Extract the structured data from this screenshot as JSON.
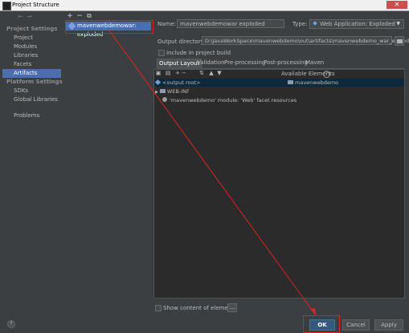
{
  "window": {
    "title": "Project Structure",
    "close_glyph": "✕"
  },
  "nav": {
    "toolbar": {
      "back": "←",
      "forward": "→"
    },
    "sections": [
      {
        "label": "Project Settings",
        "items": [
          "Project",
          "Modules",
          "Libraries",
          "Facets",
          "Artifacts"
        ]
      },
      {
        "label": "Platform Settings",
        "items": [
          "SDKs",
          "Global Libraries"
        ]
      }
    ],
    "problems": "Problems",
    "selected": "Artifacts"
  },
  "artifacts": {
    "toolbar": {
      "add": "+",
      "remove": "−",
      "copy": "⧉"
    },
    "items": [
      "mavenwebdemowar: exploded"
    ]
  },
  "form": {
    "name_label": "Name:",
    "name_value": "mavenwebdemowar exploded",
    "type_label": "Type:",
    "type_value": "Web Application: Exploded",
    "output_dir_label": "Output directory:",
    "output_dir_value": "D:\\JavaWorkSpace\\mavenwebdemo\\out\\artifacts\\mavenwebdemo_war_exploded",
    "include_build_label": "Include in project build"
  },
  "tabs": [
    "Output Layout",
    "Validation",
    "Pre-processing",
    "Post-processing",
    "Maven"
  ],
  "active_tab": "Output Layout",
  "layout": {
    "available_label": "Available Elements",
    "help_glyph": "?",
    "tree": [
      "<output root>",
      "WEB-INF",
      "'mavenwebdemo' module: 'Web' facet resources"
    ],
    "available": [
      "mavenwebdemo"
    ],
    "show_content_label": "Show content of elements",
    "dots": "..."
  },
  "footer": {
    "help": "?",
    "ok": "OK",
    "cancel": "Cancel",
    "apply": "Apply"
  },
  "colors": {
    "background": "#3c3f41",
    "selection": "#4b6eaf",
    "annotation_red": "#e02020"
  }
}
